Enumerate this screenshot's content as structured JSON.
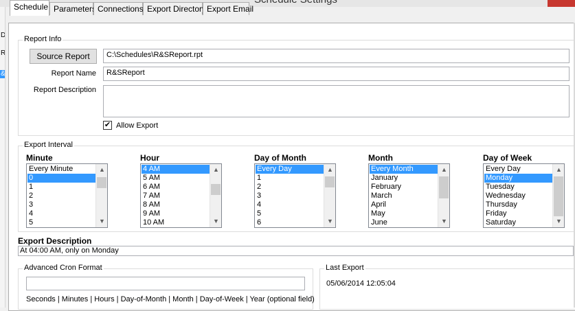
{
  "window": {
    "title": "Schedule Settings"
  },
  "left_strip": [
    "D",
    "Re",
    "&"
  ],
  "tabs": [
    "Schedule",
    "Parameters",
    "Connections",
    "Export Directory",
    "Export Email"
  ],
  "report_info": {
    "legend": "Report Info",
    "source_button": "Source Report",
    "source_path": "C:\\Schedules\\R&SReport.rpt",
    "report_name_label": "Report Name",
    "report_name": "R&SReport",
    "description_label": "Report Description",
    "description": "",
    "allow_export_label": "Allow Export",
    "allow_export_checked": "✔"
  },
  "export_interval": {
    "legend": "Export Interval",
    "columns": [
      {
        "title": "Minute",
        "items": [
          "Every Minute",
          "0",
          "1",
          "2",
          "3",
          "4",
          "5"
        ],
        "selected": 1
      },
      {
        "title": "Hour",
        "items": [
          "4 AM",
          "5 AM",
          "6 AM",
          "7 AM",
          "8 AM",
          "9 AM",
          "10 AM"
        ],
        "selected": 0
      },
      {
        "title": "Day of Month",
        "items": [
          "Every Day",
          "1",
          "2",
          "3",
          "4",
          "5",
          "6"
        ],
        "selected": 0
      },
      {
        "title": "Month",
        "items": [
          "Every Month",
          "January",
          "February",
          "March",
          "April",
          "May",
          "June"
        ],
        "selected": 0
      },
      {
        "title": "Day of Week",
        "items": [
          "Every Day",
          "Monday",
          "Tuesday",
          "Wednesday",
          "Thursday",
          "Friday",
          "Saturday"
        ],
        "selected": 1
      }
    ]
  },
  "export_description": {
    "label": "Export Description",
    "value": "At 04:00 AM, only on Monday"
  },
  "advanced_cron": {
    "legend": "Advanced Cron Format",
    "value": "",
    "help": "Seconds | Minutes | Hours | Day-of-Month | Month | Day-of-Week | Year (optional field)"
  },
  "last_export": {
    "legend": "Last Export",
    "value": "05/06/2014 12:05:04"
  },
  "colors": {
    "selection": "#3399ff",
    "panel": "#ffffff",
    "chrome": "#f0f0f0"
  }
}
